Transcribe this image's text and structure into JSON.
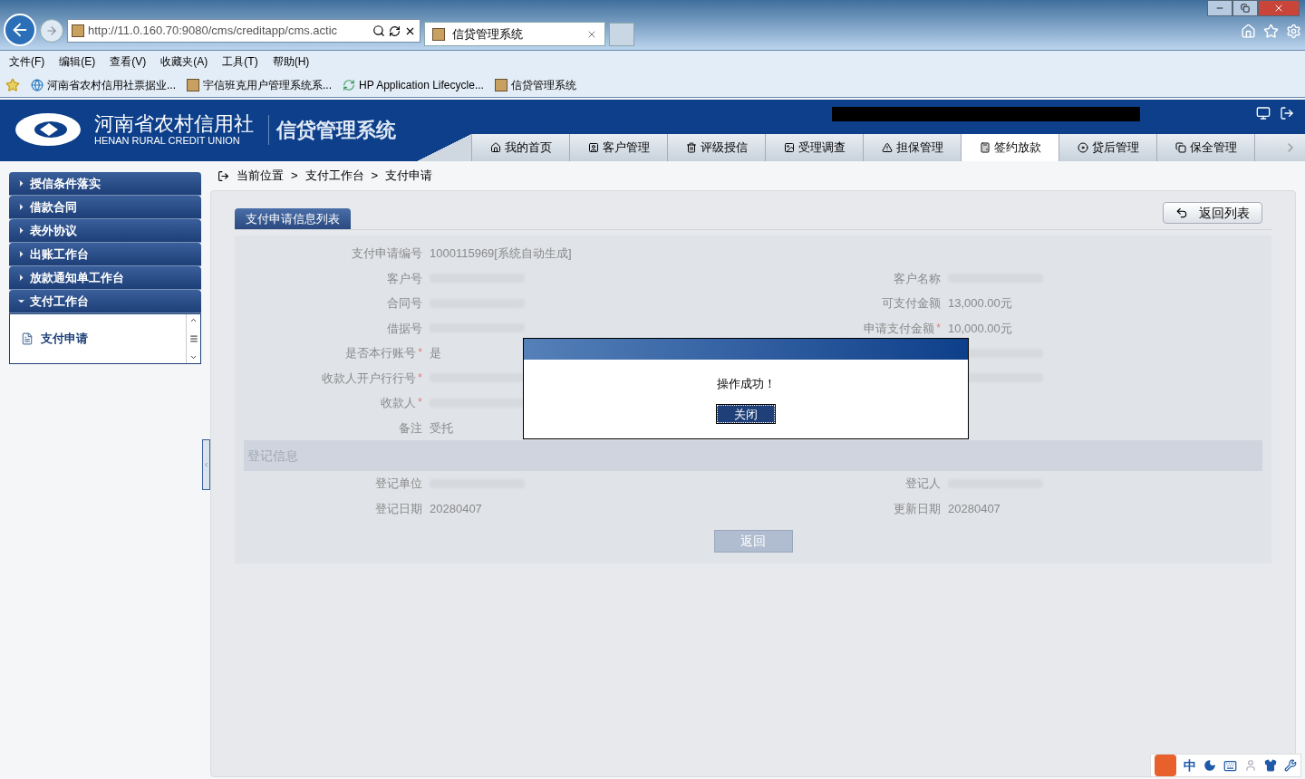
{
  "browser": {
    "address": "http://11.0.160.70:9080/cms/creditapp/cms.actic",
    "tabs": [
      {
        "title": "信贷管理系统",
        "selected": true
      }
    ],
    "menu": [
      "文件(F)",
      "编辑(E)",
      "查看(V)",
      "收藏夹(A)",
      "工具(T)",
      "帮助(H)"
    ],
    "favorites": [
      {
        "label": "河南省农村信用社票据业...",
        "kind": "ie"
      },
      {
        "label": "宇信班克用户管理系统系...",
        "kind": "page"
      },
      {
        "label": "HP Application Lifecycle...",
        "kind": "hp"
      },
      {
        "label": "信贷管理系统",
        "kind": "page"
      }
    ]
  },
  "header": {
    "org_name": "河南省农村信用社",
    "org_name_en": "HENAN RURAL CREDIT UNION",
    "system_name": "信贷管理系统",
    "nav": [
      {
        "label": "我的首页",
        "selected": false
      },
      {
        "label": "客户管理",
        "selected": false
      },
      {
        "label": "评级授信",
        "selected": false
      },
      {
        "label": "受理调查",
        "selected": false
      },
      {
        "label": "担保管理",
        "selected": false
      },
      {
        "label": "签约放款",
        "selected": true
      },
      {
        "label": "贷后管理",
        "selected": false
      },
      {
        "label": "保全管理",
        "selected": false
      }
    ]
  },
  "sidebar": {
    "items": [
      {
        "label": "授信条件落实",
        "expanded": false
      },
      {
        "label": "借款合同",
        "expanded": false
      },
      {
        "label": "表外协议",
        "expanded": false
      },
      {
        "label": "出账工作台",
        "expanded": false
      },
      {
        "label": "放款通知单工作台",
        "expanded": false
      },
      {
        "label": "支付工作台",
        "expanded": true,
        "children": [
          {
            "label": "支付申请"
          }
        ]
      }
    ]
  },
  "breadcrumb": [
    "当前位置",
    ">",
    "支付工作台",
    ">",
    "支付申请"
  ],
  "panel_tab": "支付申请信息列表",
  "back_to_list": "返回列表",
  "form": {
    "rows": [
      {
        "fields": [
          {
            "label": "支付申请编号",
            "value": "1000115969[系统自动生成]"
          }
        ]
      },
      {
        "fields": [
          {
            "label": "客户号",
            "blurred": true
          },
          {
            "label": "客户名称",
            "blurred": true
          }
        ]
      },
      {
        "fields": [
          {
            "label": "合同号",
            "blurred": true
          },
          {
            "label": "可支付金额",
            "value": "13,000.00元"
          }
        ]
      },
      {
        "fields": [
          {
            "label": "借据号",
            "blurred": true
          },
          {
            "label": "申请支付金额",
            "required_mark": "*",
            "value": "10,000.00元"
          }
        ]
      },
      {
        "fields": [
          {
            "label": "是否本行账号",
            "required_mark": "*",
            "value": "是"
          },
          {
            "blurred": true
          }
        ]
      },
      {
        "fields": [
          {
            "label": "收款人开户行行号",
            "required_mark": "*",
            "blurred": true
          },
          {
            "blurred": true
          }
        ]
      },
      {
        "fields": [
          {
            "label": "收款人",
            "required_mark": "*",
            "blurred": true
          }
        ]
      },
      {
        "fields": [
          {
            "label": "备注",
            "value": "受托"
          }
        ]
      }
    ],
    "section": "登记信息",
    "section_rows": [
      {
        "fields": [
          {
            "label": "登记单位",
            "blurred": true
          },
          {
            "label": "登记人",
            "blurred": true
          }
        ]
      },
      {
        "fields": [
          {
            "label": "登记日期",
            "value": "20280407"
          },
          {
            "label": "更新日期",
            "value": "20280407"
          }
        ]
      }
    ],
    "button": "返回"
  },
  "dialog": {
    "message": "操作成功！",
    "button": "关闭"
  },
  "ime": {
    "language": "中"
  }
}
